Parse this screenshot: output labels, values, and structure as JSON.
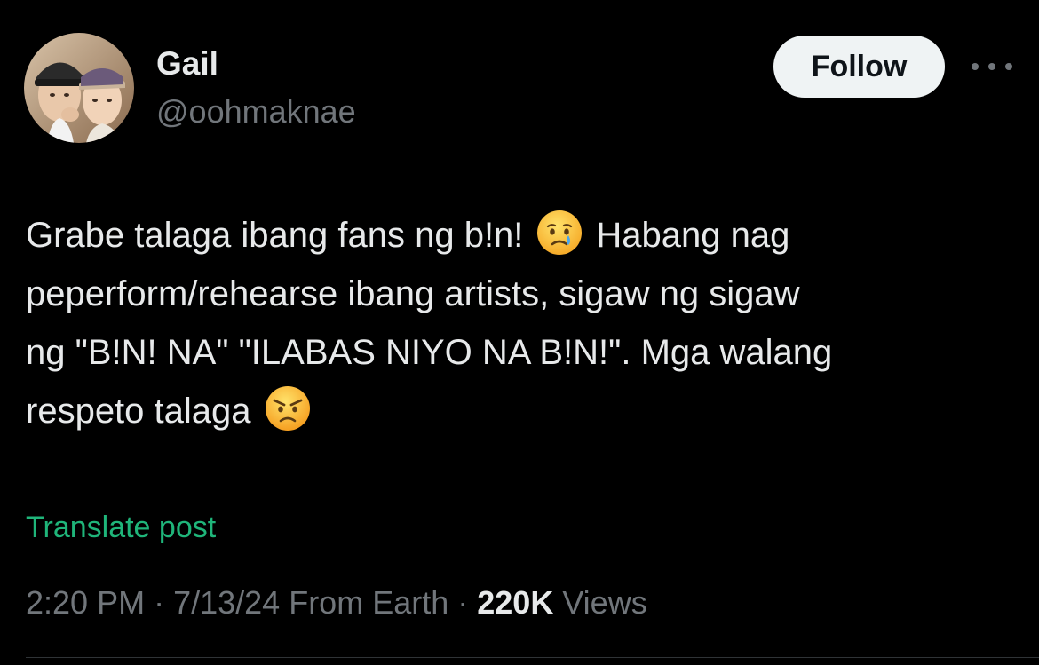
{
  "author": {
    "display_name": "Gail",
    "handle": "@oohmaknae",
    "avatar_icon": "profile-photo"
  },
  "actions": {
    "follow_label": "Follow",
    "more_icon": "more-horizontal-icon"
  },
  "post": {
    "lines": [
      {
        "before": "Grabe talaga ibang fans ng b!n!",
        "emoji": "crying-face",
        "after": "Habang nag"
      },
      {
        "text": "peperform/rehearse ibang artists, sigaw ng sigaw"
      },
      {
        "text": "ng \"B!N! NA\" \"ILABAS NIYO NA B!N!\". Mga walang"
      },
      {
        "before": "respeto talaga",
        "emoji": "angry-face"
      }
    ],
    "translate_label": "Translate post"
  },
  "meta": {
    "time": "2:20 PM",
    "sep1": " · ",
    "date": "7/13/24",
    "location": " From Earth",
    "sep2": " · ",
    "views_count": "220K",
    "views_label": " Views"
  },
  "colors": {
    "background": "#000000",
    "primary_text": "#e7e9ea",
    "secondary_text": "#71767b",
    "translate_link": "#1fb57a",
    "follow_button_bg": "#eff3f4"
  }
}
